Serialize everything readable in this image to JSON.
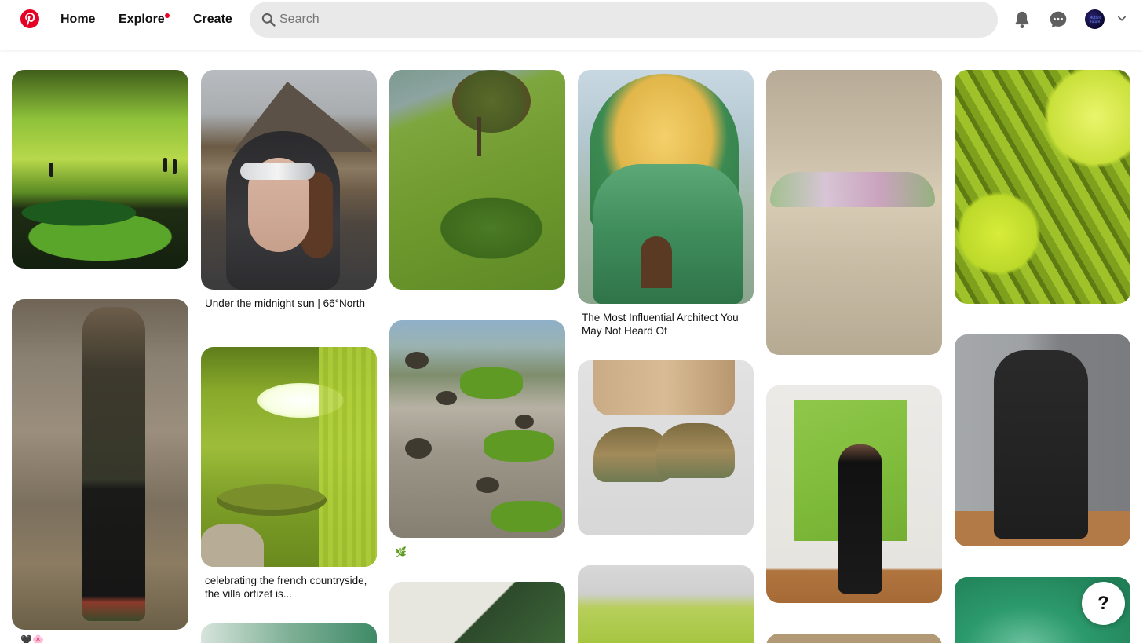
{
  "header": {
    "logo_icon": "pinterest-logo-icon",
    "brand_color": "#e60023",
    "nav": [
      {
        "label": "Home"
      },
      {
        "label": "Explore",
        "has_notification_dot": true
      },
      {
        "label": "Create"
      }
    ],
    "search": {
      "placeholder": "Search",
      "value": ""
    },
    "icons": [
      "bell-icon",
      "chat-bubble-icon",
      "avatar",
      "chevron-down-icon"
    ],
    "avatar_text": "Mutant Future"
  },
  "pins": [
    {
      "id": "p1",
      "caption": ""
    },
    {
      "id": "p2",
      "caption": "",
      "emoji": "🖤🌸"
    },
    {
      "id": "p3",
      "caption": "Under the midnight sun | 66°North"
    },
    {
      "id": "p4",
      "caption": "celebrating the french countryside, the villa ortizet is..."
    },
    {
      "id": "p5",
      "caption": ""
    },
    {
      "id": "p6",
      "caption": ""
    },
    {
      "id": "p7",
      "caption": "",
      "emoji": "🌿"
    },
    {
      "id": "p8",
      "caption": ""
    },
    {
      "id": "p9",
      "caption": "The Most Influential Architect You May Not Heard Of"
    },
    {
      "id": "p10",
      "caption": ""
    },
    {
      "id": "p11",
      "caption": ""
    },
    {
      "id": "p12",
      "caption": ""
    },
    {
      "id": "p13",
      "caption": ""
    },
    {
      "id": "p14",
      "caption": ""
    },
    {
      "id": "p15",
      "caption": ""
    },
    {
      "id": "p16",
      "caption": ""
    },
    {
      "id": "p17",
      "caption": ""
    }
  ],
  "help_button": {
    "label": "?"
  }
}
